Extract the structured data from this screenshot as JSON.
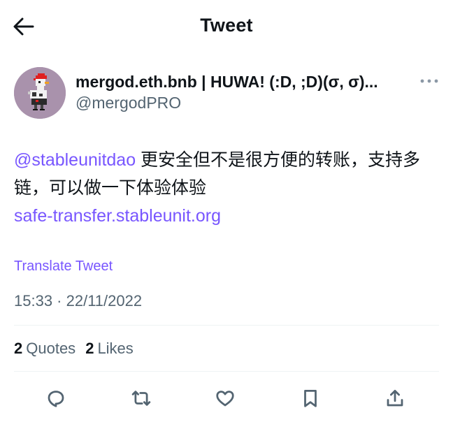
{
  "header": {
    "title": "Tweet",
    "back_icon": "arrow-left-icon"
  },
  "author": {
    "display_name": "mergod.eth.bnb | HUWA! (:D, ;D)(σ, σ)...",
    "handle": "@mergodPRO",
    "avatar_bg": "#a992ac"
  },
  "tweet": {
    "mention": "@stableunitdao",
    "body": " 更安全但不是很方便的转账，支持多链，可以做一下体验体验",
    "link": "safe-transfer.stableunit.org",
    "translate_label": "Translate Tweet",
    "timestamp": "15:33 · 22/11/2022"
  },
  "stats": {
    "quotes_count": "2",
    "quotes_label": "Quotes",
    "likes_count": "2",
    "likes_label": "Likes"
  },
  "actions": [
    "reply-icon",
    "retweet-icon",
    "like-icon",
    "bookmark-icon",
    "share-icon"
  ],
  "colors": {
    "accent": "#7856ff",
    "text": "#0f1419",
    "secondary": "#536471",
    "divider": "#eff3f4"
  }
}
